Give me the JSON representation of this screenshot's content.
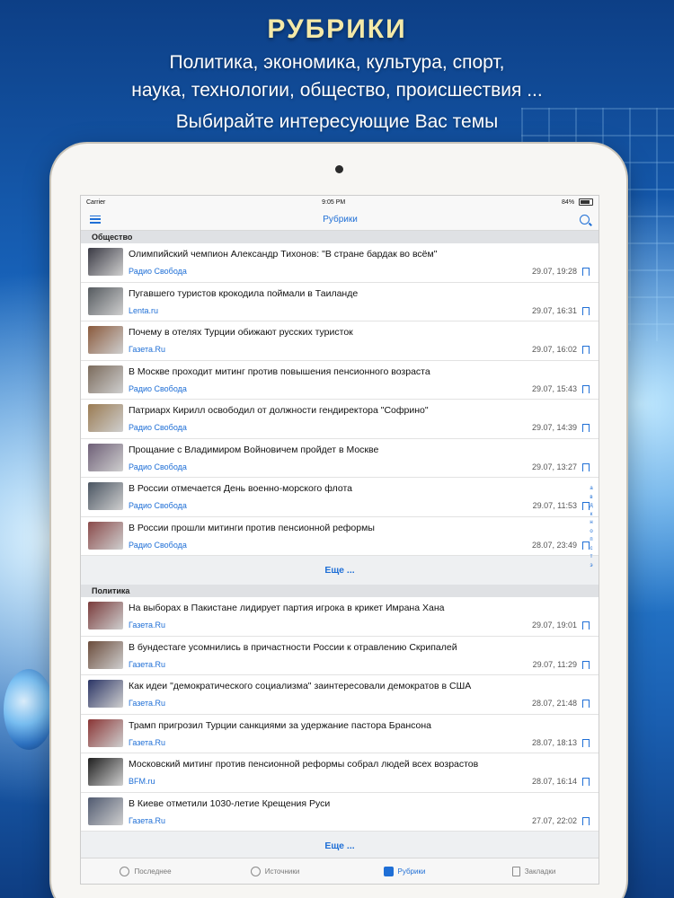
{
  "promo": {
    "title": "РУБРИКИ",
    "line1": "Политика, экономика, культура, спорт,",
    "line2": "наука, технологии, общество, происшествия ...",
    "line3": "Выбирайте интересующие Вас темы"
  },
  "status_bar": {
    "carrier": "Carrier",
    "time": "9:05 PM",
    "battery": "84%"
  },
  "navbar": {
    "title": "Рубрики"
  },
  "sections": [
    {
      "title": "Общество",
      "items": [
        {
          "title": "Олимпийский чемпион Александр Тихонов: \"В стране бардак во всём\"",
          "source": "Радио Свобода",
          "time": "29.07, 19:28",
          "color": "#3a3a44"
        },
        {
          "title": "Пугавшего туристов крокодила поймали в Таиланде",
          "source": "Lenta.ru",
          "time": "29.07, 16:31",
          "color": "#555a5f"
        },
        {
          "title": "Почему в отелях Турции обижают русских туристок",
          "source": "Газета.Ru",
          "time": "29.07, 16:02",
          "color": "#8a5a3c"
        },
        {
          "title": "В Москве проходит митинг против повышения пенсионного возраста",
          "source": "Радио Свобода",
          "time": "29.07, 15:43",
          "color": "#7b6b5c"
        },
        {
          "title": "Патриарх Кирилл освободил от должности гендиректора \"Софрино\"",
          "source": "Радио Свобода",
          "time": "29.07, 14:39",
          "color": "#9a7b52"
        },
        {
          "title": "Прощание с Владимиром Войновичем пройдет в Москве",
          "source": "Радио Свобода",
          "time": "29.07, 13:27",
          "color": "#6e5f77"
        },
        {
          "title": "В России отмечается День военно-морского флота",
          "source": "Радио Свобода",
          "time": "29.07, 11:53",
          "color": "#4a5562"
        },
        {
          "title": "В России прошли митинги против пенсионной реформы",
          "source": "Радио Свобода",
          "time": "28.07, 23:49",
          "color": "#8a4a4a"
        }
      ],
      "more": "Еще ..."
    },
    {
      "title": "Политика",
      "items": [
        {
          "title": "На выборах в Пакистане лидирует партия игрока в крикет Имрана Хана",
          "source": "Газета.Ru",
          "time": "29.07, 19:01",
          "color": "#7a3b3b"
        },
        {
          "title": "В бундестаге усомнились в причастности России к отравлению Скрипалей",
          "source": "Газета.Ru",
          "time": "29.07, 11:29",
          "color": "#6b4c3b"
        },
        {
          "title": "Как идеи \"демократического социализма\" заинтересовали демократов в США",
          "source": "Газета.Ru",
          "time": "28.07, 21:48",
          "color": "#2b3566"
        },
        {
          "title": "Трамп пригрозил Турции санкциями за удержание пастора Брансона",
          "source": "Газета.Ru",
          "time": "28.07, 18:13",
          "color": "#8a3535"
        },
        {
          "title": "Московский митинг против пенсионной реформы собрал людей всех возрастов",
          "source": "BFM.ru",
          "time": "28.07, 16:14",
          "color": "#1f1f1f"
        },
        {
          "title": "В Киеве отметили 1030-летие Крещения Руси",
          "source": "Газета.Ru",
          "time": "27.07, 22:02",
          "color": "#505a70"
        }
      ],
      "more": "Еще ..."
    }
  ],
  "index_letters": [
    "а",
    "в",
    "д",
    "к",
    "н",
    "о",
    "п",
    "с",
    "т",
    "э"
  ],
  "tabs": [
    {
      "label": "Последнее",
      "icon": "clock-icon",
      "active": false
    },
    {
      "label": "Источники",
      "icon": "copyright-icon",
      "active": false
    },
    {
      "label": "Рубрики",
      "icon": "rubrics-icon",
      "active": true
    },
    {
      "label": "Закладки",
      "icon": "bookmark-icon",
      "active": false
    }
  ],
  "colors": {
    "accent": "#1f6fd6",
    "promo_title": "#f4e9a8"
  }
}
